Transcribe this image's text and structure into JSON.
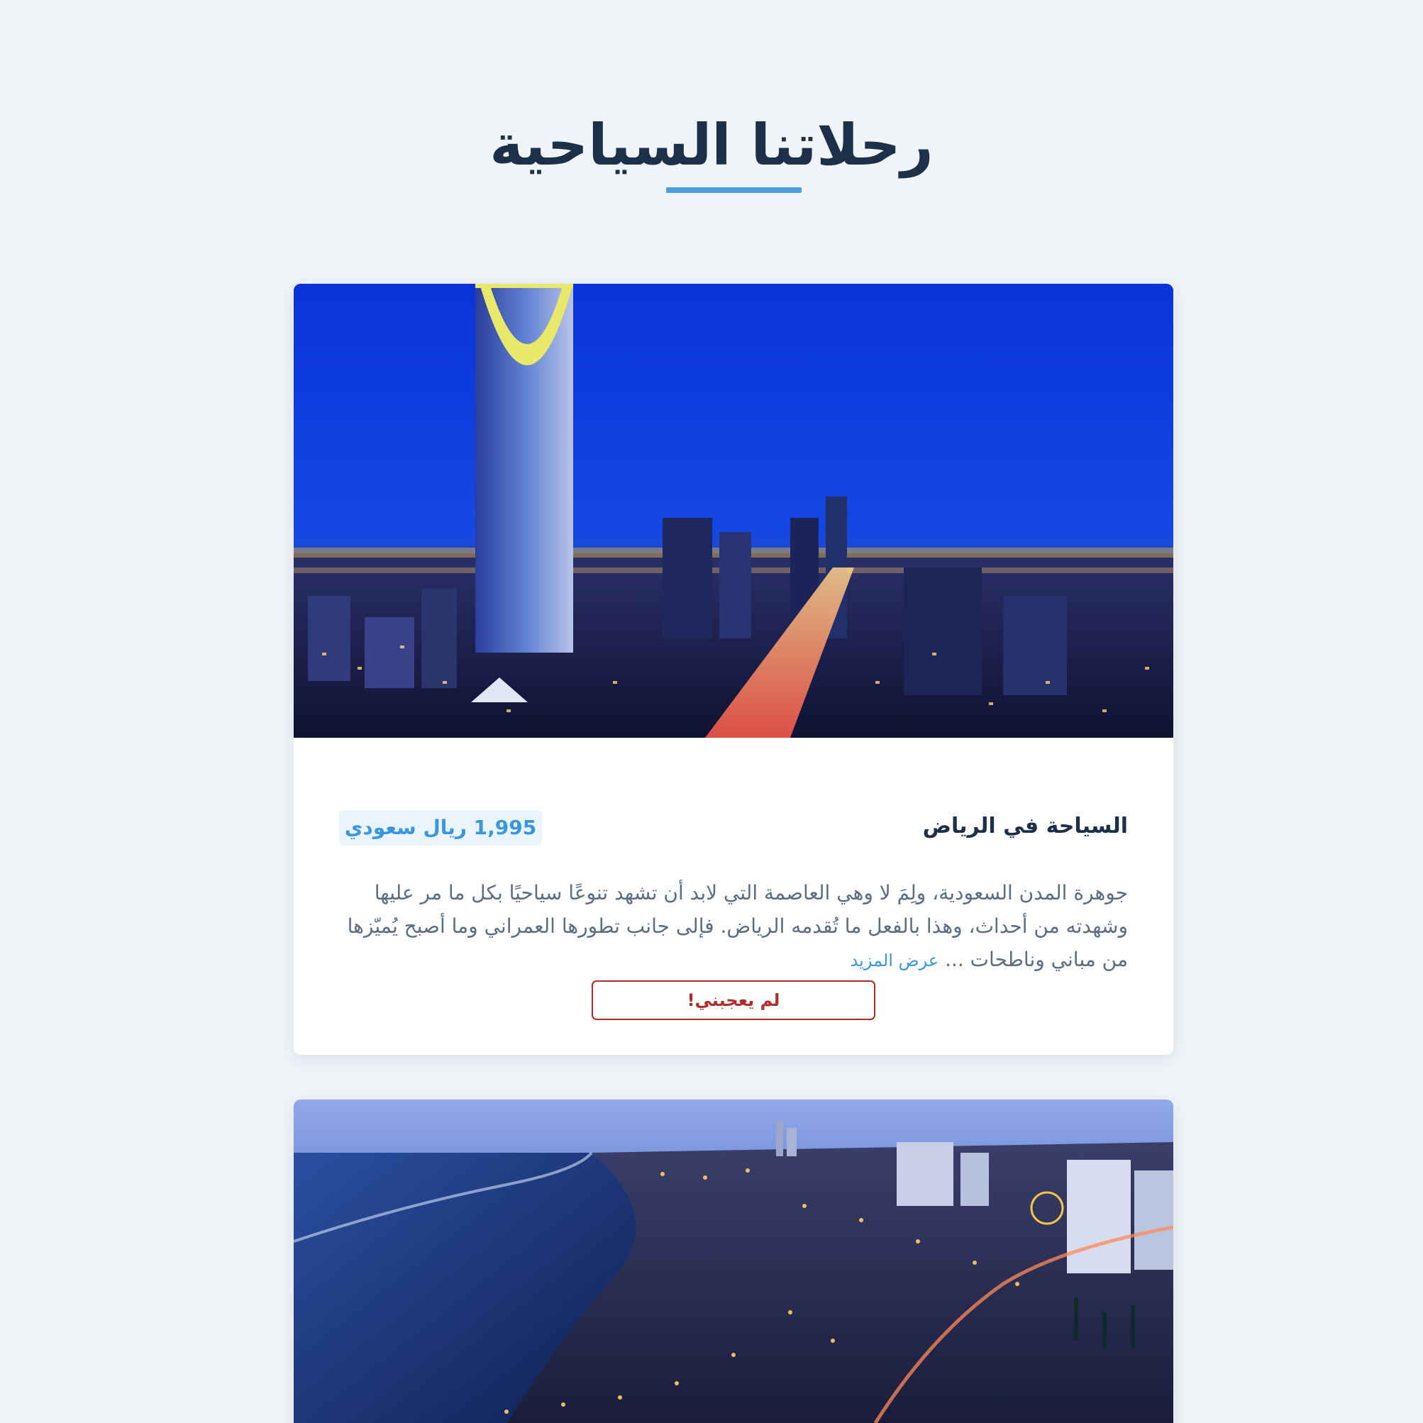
{
  "page": {
    "title": "رحلاتنا السياحية"
  },
  "trips": [
    {
      "name": "السياحة في الرياض",
      "price": "1,995 ريال سعودي",
      "description": "جوهرة المدن السعودية، ولِمَ لا وهي العاصمة التي لابد أن تشهد تنوعًا سياحيًا بكل ما مر عليها وشهدته من أحداث، وهذا بالفعل ما تُقدمه الرياض. فإلى جانب تطورها العمراني وما أصبح يُميّزها من مباني وناطحات ...",
      "more_label": "عرض المزيد",
      "dislike_label": "لم يعجبني!",
      "image_icon": "riyadh-skyline-image"
    },
    {
      "image_icon": "jeddah-coast-image"
    }
  ],
  "colors": {
    "background": "#f0f4f8",
    "heading": "#1d3049",
    "accent": "#4a9fe0",
    "price_text": "#3a96dd",
    "price_bg": "#e9f4fd",
    "body_text": "#5b6d82",
    "dislike": "#b32c2c"
  }
}
